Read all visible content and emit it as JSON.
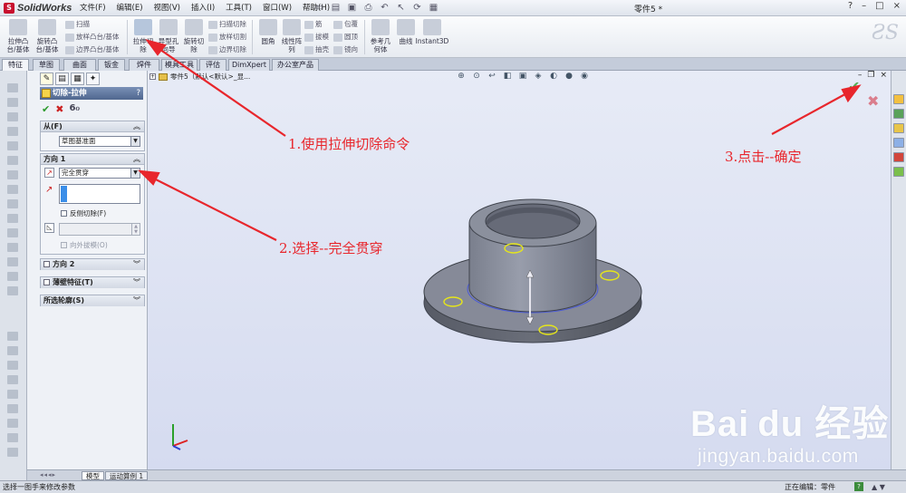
{
  "app": {
    "logo_text": "SolidWorks",
    "doc_title": "零件5 *"
  },
  "menu": [
    "文件(F)",
    "编辑(E)",
    "视图(V)",
    "插入(I)",
    "工具(T)",
    "窗口(W)",
    "帮助(H)"
  ],
  "window_buttons": [
    "?",
    "–",
    "□",
    "×"
  ],
  "commands": {
    "extrude_boss": "拉伸凸\n台/基体",
    "revolve_boss": "旋转凸\n台/基体",
    "sweep": "扫描",
    "loft_boss": "放样凸台/基体",
    "boundary_boss": "边界凸台/基体",
    "extrude_cut": "拉伸切\n除",
    "hole_wizard": "异型孔\n向导",
    "revolve_cut": "旋转切\n除",
    "sweep_cut": "扫描切除",
    "loft_cut": "放样切割",
    "boundary_cut": "边界切除",
    "fillet": "圆角",
    "linear_pattern": "线性阵\n列",
    "rib": "筋",
    "draft": "拔模",
    "shell": "抽壳",
    "wrap": "包覆",
    "dome": "圆顶",
    "mirror": "镜向",
    "ref_geometry": "参考几\n何体",
    "curves": "曲线",
    "instant3d": "Instant3D"
  },
  "tabs": [
    "特征",
    "草图",
    "曲面",
    "钣金",
    "焊件",
    "模具工具",
    "评估",
    "DimXpert",
    "办公室产品"
  ],
  "property_manager": {
    "title": "切除-拉伸",
    "help": "?",
    "ok": "✔",
    "cancel": "✖",
    "preview": "6ℴ",
    "from": {
      "label": "从(F)",
      "value": "草图基准面"
    },
    "direction1": {
      "label": "方向 1",
      "end_condition": "完全贯穿",
      "flip_side": "反侧切除(F)",
      "draft_outward": "向外拔模(O)"
    },
    "direction2": {
      "label": "方向 2"
    },
    "thin_feature": {
      "label": "薄壁特征(T)"
    },
    "selected_contours": {
      "label": "所选轮廓(S)"
    }
  },
  "bottom_tabs": [
    "模型",
    "运动算例 1"
  ],
  "feature_tree": {
    "node": "零件5（默认<默认>_显..."
  },
  "status": {
    "left": "选择一图手来修改参数",
    "right": "正在编辑：零件"
  },
  "annotations": {
    "step1": "1.使用拉伸切除命令",
    "step2": "2.选择--完全贯穿",
    "step3": "3.点击--确定"
  },
  "watermark": {
    "brand": "Bai du 经验",
    "url": "jingyan.baidu.com"
  },
  "colors": {
    "annotation": "#e8262c",
    "pm_header": "#5a7199",
    "viewport_bg": "#dde2f3",
    "part": "#7f8493"
  },
  "icons": {
    "ok": "check-icon",
    "cancel": "close-icon",
    "preview": "glasses-icon",
    "help": "help-icon"
  }
}
